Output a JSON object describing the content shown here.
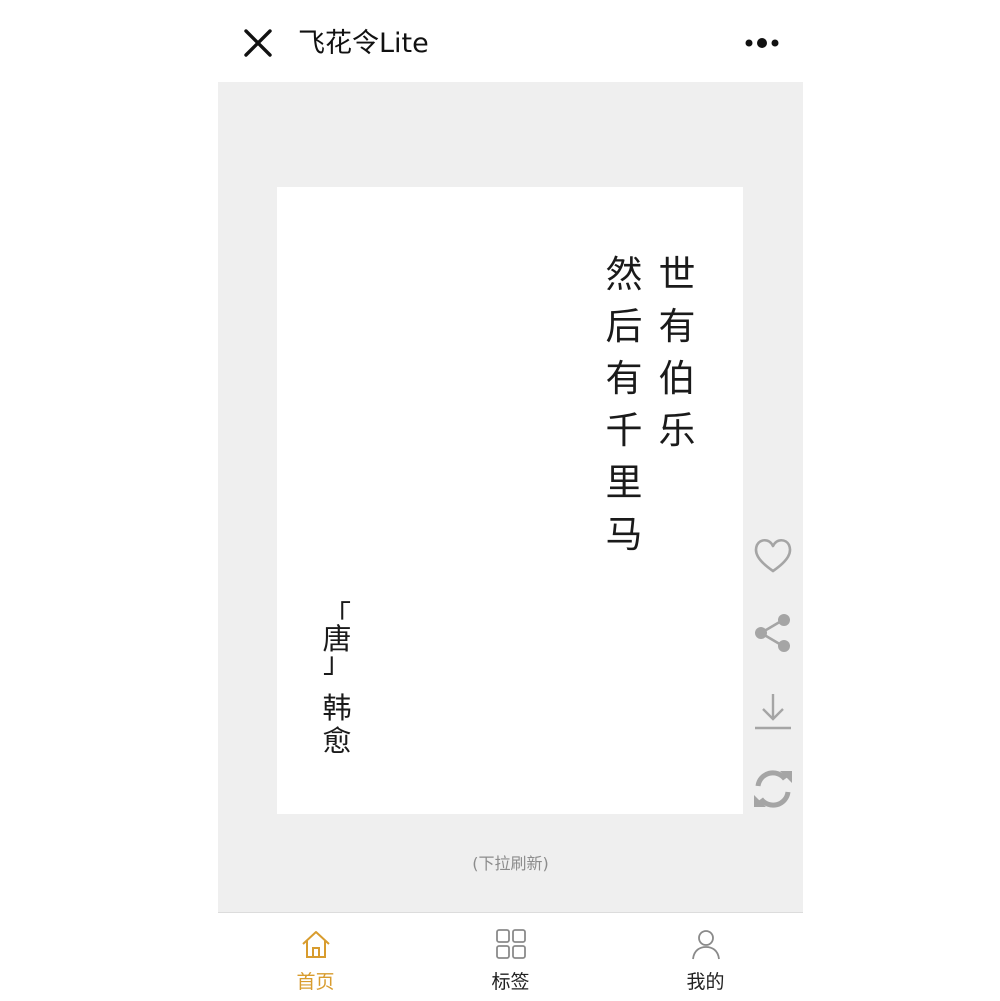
{
  "header": {
    "title": "飞花令Lite",
    "close_icon": "close-icon",
    "more_icon": "more-dots-icon"
  },
  "poem": {
    "lines": [
      [
        "世",
        "有",
        "伯",
        "乐"
      ],
      [
        "然",
        "后",
        "有",
        "千",
        "里",
        "马"
      ]
    ],
    "dynasty": "唐",
    "dynasty_bracket_open": "「",
    "dynasty_bracket_close": "」",
    "author": [
      "韩",
      "愈"
    ]
  },
  "actions": [
    {
      "name": "like-icon"
    },
    {
      "name": "share-icon"
    },
    {
      "name": "download-icon"
    },
    {
      "name": "refresh-icon"
    }
  ],
  "refresh_hint": "(下拉刷新)",
  "tabs": [
    {
      "label": "首页",
      "icon": "home-icon",
      "active": true
    },
    {
      "label": "标签",
      "icon": "grid-icon",
      "active": false
    },
    {
      "label": "我的",
      "icon": "user-icon",
      "active": false
    }
  ],
  "colors": {
    "accent": "#d89c2e",
    "background": "#efefef",
    "card": "#ffffff",
    "icon_gray": "#a5a5a5"
  }
}
